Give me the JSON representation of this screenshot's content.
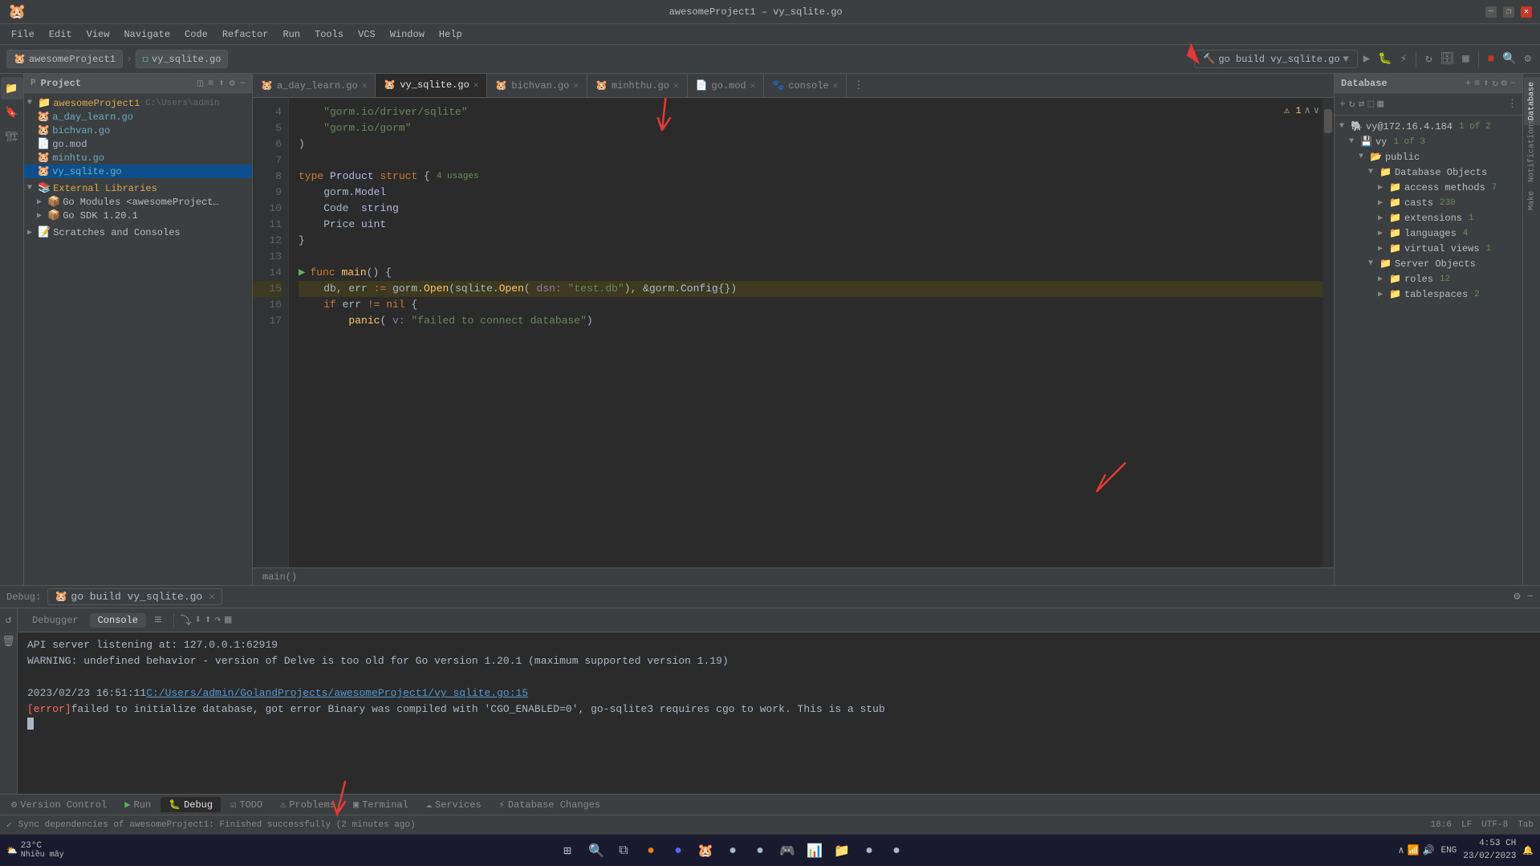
{
  "title_bar": {
    "app_name": "awesomeProject1 – vy_sqlite.go",
    "min": "—",
    "max": "❐",
    "close": "✕"
  },
  "menu": {
    "items": [
      "File",
      "Edit",
      "View",
      "Navigate",
      "Code",
      "Refactor",
      "Run",
      "Tools",
      "VCS",
      "Window",
      "Help"
    ]
  },
  "toolbar": {
    "project_label": "awesomeProject1",
    "file_label": "vy_sqlite.go",
    "build_config": "go build vy_sqlite.go",
    "run_label": "▶",
    "debug_label": "🐛",
    "profile_label": "⚡",
    "stop_label": "■",
    "search_label": "🔍"
  },
  "project_panel": {
    "title": "Project",
    "root": "awesomeProject1",
    "root_path": "C:\\Users\\admin",
    "items": [
      {
        "label": "a_day_learn.go",
        "type": "go-file",
        "indent": 2
      },
      {
        "label": "bichvan.go",
        "type": "go-file",
        "indent": 2
      },
      {
        "label": "go.mod",
        "type": "mod-file",
        "indent": 2
      },
      {
        "label": "minhtu.go",
        "type": "go-file",
        "indent": 2
      },
      {
        "label": "vy_sqlite.go",
        "type": "go-file",
        "indent": 2,
        "selected": true
      },
      {
        "label": "External Libraries",
        "type": "dir",
        "indent": 1
      },
      {
        "label": "Go Modules <awesomeProject…",
        "type": "dir",
        "indent": 2
      },
      {
        "label": "Go SDK 1.20.1",
        "type": "dir",
        "indent": 2
      },
      {
        "label": "Scratches and Consoles",
        "type": "dir",
        "indent": 1
      }
    ]
  },
  "tabs": [
    {
      "label": "a_day_learn.go",
      "active": false
    },
    {
      "label": "vy_sqlite.go",
      "active": true
    },
    {
      "label": "bichvan.go",
      "active": false
    },
    {
      "label": "minhthu.go",
      "active": false
    },
    {
      "label": "go.mod",
      "active": false
    },
    {
      "label": "console",
      "active": false
    }
  ],
  "code": {
    "lines": [
      {
        "num": "4",
        "content": "    \"gorm.io/driver/sqlite\"",
        "type": "string"
      },
      {
        "num": "5",
        "content": "    \"gorm.io/gorm\"",
        "type": "string"
      },
      {
        "num": "6",
        "content": ")"
      },
      {
        "num": "7",
        "content": ""
      },
      {
        "num": "8",
        "content": "type Product struct {",
        "usages": "4 usages"
      },
      {
        "num": "9",
        "content": "    gorm.Model"
      },
      {
        "num": "10",
        "content": "    Code  string"
      },
      {
        "num": "11",
        "content": "    Price uint"
      },
      {
        "num": "12",
        "content": "}"
      },
      {
        "num": "13",
        "content": ""
      },
      {
        "num": "14",
        "content": "func main() {",
        "run_arrow": true
      },
      {
        "num": "15",
        "content": "    db, err := gorm.Open(sqlite.Open( dsn: \"test.db\"), &gorm.Config{})"
      },
      {
        "num": "16",
        "content": "    if err != nil {"
      },
      {
        "num": "17",
        "content": "        panic( v: \"failed to connect database\")"
      }
    ],
    "breadcrumb": "main()"
  },
  "database_panel": {
    "title": "Database",
    "connection": "vy@172.16.4.184",
    "connection_count": "1 of 2",
    "db_name": "vy",
    "db_count": "1 of 3",
    "schema": "public",
    "sections": [
      {
        "label": "Database Objects",
        "expanded": true,
        "children": [
          {
            "label": "access methods",
            "count": "7",
            "indent": 3
          },
          {
            "label": "casts",
            "count": "230",
            "indent": 3
          },
          {
            "label": "extensions",
            "count": "1",
            "indent": 3
          },
          {
            "label": "languages",
            "count": "4",
            "indent": 3
          },
          {
            "label": "virtual views",
            "count": "1",
            "indent": 3
          }
        ]
      },
      {
        "label": "Server Objects",
        "expanded": true,
        "children": [
          {
            "label": "roles",
            "count": "12",
            "indent": 3
          },
          {
            "label": "tablespaces",
            "count": "2",
            "indent": 3
          }
        ]
      }
    ]
  },
  "debug_panel": {
    "label": "Debug:",
    "current_tab": "go build vy_sqlite.go",
    "tabs": [
      "Debugger",
      "Console"
    ],
    "active_tab": "Console",
    "output": [
      {
        "type": "normal",
        "text": "API server listening at: 127.0.0.1:62919"
      },
      {
        "type": "warning",
        "text": "WARNING: undefined behavior - version of Delve is too old for Go version 1.20.1 (maximum supported version 1.19)"
      },
      {
        "type": "blank"
      },
      {
        "type": "link",
        "prefix": "2023/02/23 16:51:11 ",
        "link": "C:/Users/admin/GolandProjects/awesomeProject1/vy_sqlite.go:15"
      },
      {
        "type": "error",
        "tag": "[error]",
        "text": " failed to initialize database, got error Binary was compiled with 'CGO_ENABLED=0', go-sqlite3 requires cgo to work. This is a stub"
      }
    ]
  },
  "bottom_tabs": [
    {
      "label": "Version Control",
      "icon": "⚙"
    },
    {
      "label": "Run",
      "icon": "▶"
    },
    {
      "label": "Debug",
      "icon": "🐛",
      "active": true
    },
    {
      "label": "TODO",
      "icon": "☑"
    },
    {
      "label": "Problems",
      "icon": "⚠"
    },
    {
      "label": "Terminal",
      "icon": "▣"
    },
    {
      "label": "Services",
      "icon": "☁"
    },
    {
      "label": "Database Changes",
      "icon": "⚡"
    }
  ],
  "status_bar": {
    "sync_message": "Sync dependencies of awesomeProject1: Finished successfully (2 minutes ago)",
    "position": "18:6",
    "encoding": "UTF-8",
    "line_sep": "LF",
    "indent": "Tab"
  },
  "taskbar": {
    "weather_temp": "23°C",
    "weather_desc": "Nhiều mây",
    "time": "4:53 CH",
    "date": "23/02/2023",
    "lang": "ENG"
  },
  "right_tabs": [
    "Database",
    "Notifications",
    "Make"
  ]
}
